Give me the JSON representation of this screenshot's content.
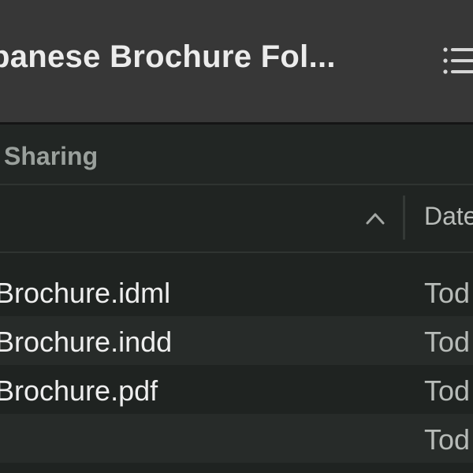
{
  "window": {
    "title": "panese Brochure Fol..."
  },
  "sidebar_section": {
    "label": "Sharing"
  },
  "columns": {
    "date_label": "Date"
  },
  "files": [
    {
      "name": "Brochure.idml",
      "date": "Tod"
    },
    {
      "name": "Brochure.indd",
      "date": "Tod"
    },
    {
      "name": "Brochure.pdf",
      "date": "Tod"
    },
    {
      "name": "",
      "date": "Tod"
    }
  ],
  "icons": {
    "view_toggle": "list-view-icon",
    "sort": "chevron-up-icon"
  },
  "colors": {
    "row_even": "#1f2321",
    "row_odd": "#272b29",
    "titlebar": "#373737"
  }
}
